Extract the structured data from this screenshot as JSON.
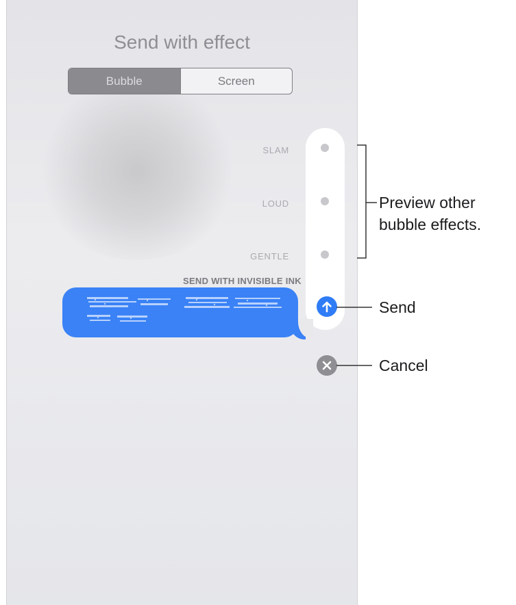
{
  "screen": {
    "title": "Send with effect",
    "segments": [
      "Bubble",
      "Screen"
    ],
    "selected_segment": "Bubble"
  },
  "effects": [
    {
      "label": "SLAM"
    },
    {
      "label": "LOUD"
    },
    {
      "label": "GENTLE"
    }
  ],
  "selected_effect_label": "SEND WITH INVISIBLE INK",
  "message": {
    "text": "",
    "obscured": true,
    "color": "#3a82f6"
  },
  "buttons": {
    "send_icon": "arrow-up-icon",
    "cancel_icon": "close-icon"
  },
  "callouts": {
    "preview_line1": "Preview other",
    "preview_line2": "bubble effects.",
    "send": "Send",
    "cancel": "Cancel"
  },
  "colors": {
    "accent": "#2f7cf6",
    "bubble": "#3a82f6",
    "cancel": "#8e8e93"
  }
}
